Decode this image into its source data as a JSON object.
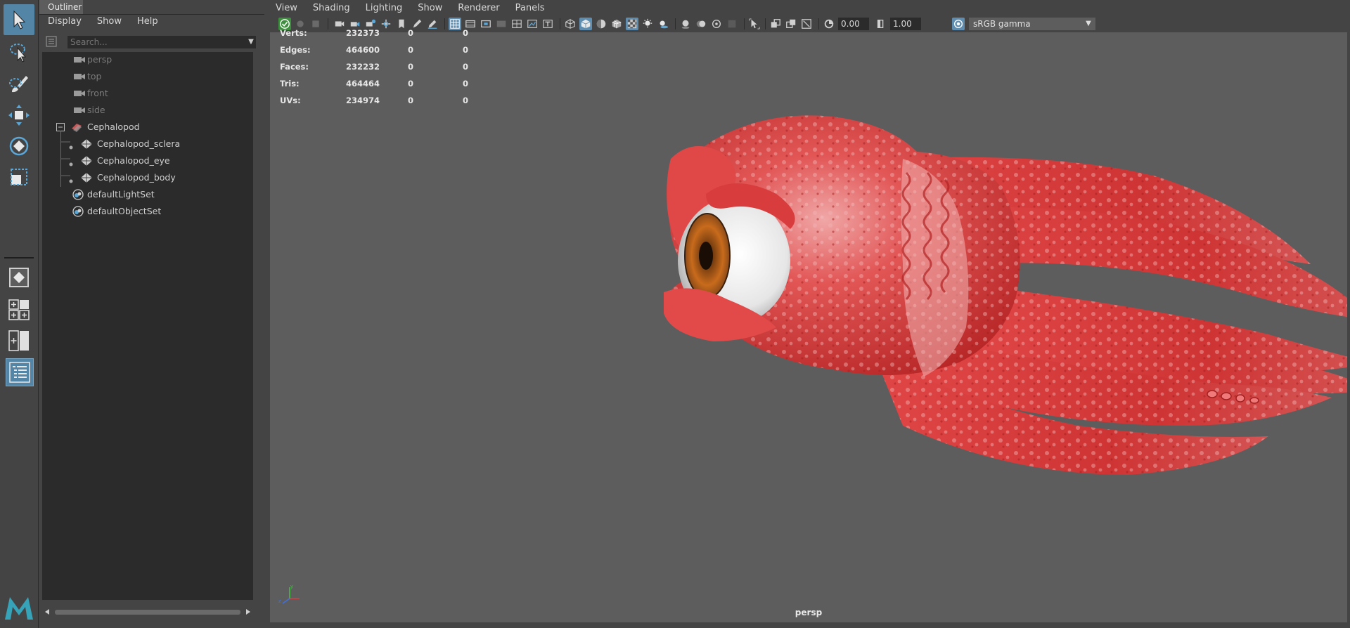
{
  "outliner": {
    "tab_label": "Outliner",
    "menu": [
      "Display",
      "Show",
      "Help"
    ],
    "search_placeholder": "Search...",
    "items": [
      {
        "label": "persp",
        "icon": "camera-icon",
        "dim": true
      },
      {
        "label": "top",
        "icon": "camera-icon",
        "dim": true
      },
      {
        "label": "front",
        "icon": "camera-icon",
        "dim": true
      },
      {
        "label": "side",
        "icon": "camera-icon",
        "dim": true
      },
      {
        "label": "Cephalopod",
        "icon": "group-icon",
        "dim": false
      },
      {
        "label": "Cephalopod_sclera",
        "icon": "mesh-icon",
        "dim": false
      },
      {
        "label": "Cephalopod_eye",
        "icon": "mesh-icon",
        "dim": false
      },
      {
        "label": "Cephalopod_body",
        "icon": "mesh-icon",
        "dim": false
      },
      {
        "label": "defaultLightSet",
        "icon": "set-icon",
        "dim": false
      },
      {
        "label": "defaultObjectSet",
        "icon": "set-icon",
        "dim": false
      }
    ]
  },
  "viewport": {
    "menu": [
      "View",
      "Shading",
      "Lighting",
      "Show",
      "Renderer",
      "Panels"
    ],
    "exposure": "0.00",
    "gamma": "1.00",
    "color_space": "sRGB gamma",
    "camera": "persp",
    "hud": [
      {
        "label": "Verts:",
        "v1": "232373",
        "v2": "0",
        "v3": "0"
      },
      {
        "label": "Edges:",
        "v1": "464600",
        "v2": "0",
        "v3": "0"
      },
      {
        "label": "Faces:",
        "v1": "232232",
        "v2": "0",
        "v3": "0"
      },
      {
        "label": "Tris:",
        "v1": "464464",
        "v2": "0",
        "v3": "0"
      },
      {
        "label": "UVs:",
        "v1": "234974",
        "v2": "0",
        "v3": "0"
      }
    ]
  },
  "colors": {
    "accent": "#5285a6",
    "viewport_bg": "#5d5d5d",
    "panel_bg": "#444444",
    "creature_red": "#d63a3a"
  },
  "tools": [
    "select-tool-icon",
    "lasso-tool-icon",
    "paint-select-tool-icon",
    "move-tool-icon",
    "rotate-tool-icon",
    "scale-tool-icon"
  ]
}
